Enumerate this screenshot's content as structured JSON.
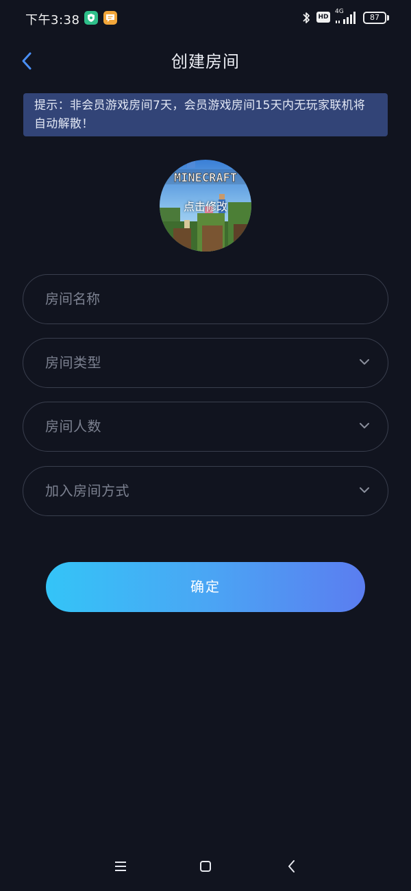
{
  "status_bar": {
    "time": "下午3:38",
    "network": "4G",
    "hd_label": "HD",
    "battery": "87",
    "icons": [
      "shield-notification-icon",
      "chat-notification-icon",
      "bluetooth-icon",
      "hd-icon",
      "signal-icon",
      "battery-icon"
    ]
  },
  "header": {
    "title": "创建房间",
    "back_icon": "chevron-left-icon"
  },
  "notice": {
    "text": "提示：非会员游戏房间7天，会员游戏房间15天内无玩家联机将自动解散！"
  },
  "avatar": {
    "caption": "点击修改",
    "logo_text": "MINECRAFT"
  },
  "form": {
    "room_name_placeholder": "房间名称",
    "room_type_label": "房间类型",
    "room_size_label": "房间人数",
    "join_method_label": "加入房间方式"
  },
  "confirm_label": "确定",
  "nav": {
    "icons": [
      "menu-icon",
      "home-icon",
      "back-icon"
    ]
  },
  "colors": {
    "background": "#11141f",
    "notice_bg": "#324477",
    "accent": "#4a8ff5",
    "button_gradient_start": "#34c4f7",
    "button_gradient_end": "#5b7df0",
    "field_border": "#3a3f4e"
  }
}
